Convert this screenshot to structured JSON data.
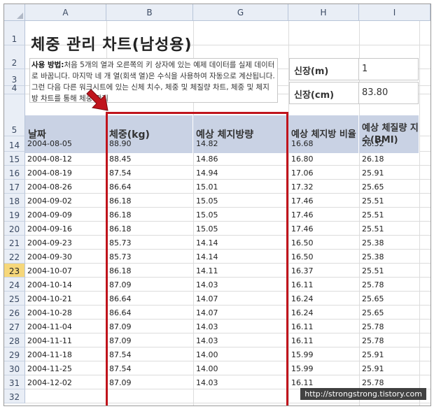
{
  "columns": [
    "A",
    "B",
    "G",
    "H",
    "I"
  ],
  "rows": [
    "1",
    "2",
    "3",
    "4",
    "5",
    "14",
    "15",
    "16",
    "17",
    "18",
    "19",
    "20",
    "21",
    "22",
    "23",
    "24",
    "25",
    "26",
    "27",
    "28",
    "29",
    "30",
    "31",
    "32"
  ],
  "selected_row": "23",
  "title": "체중 관리 차트(남성용)",
  "description": {
    "bold": "사용 방법:",
    "text": "처음 5개의 열과 오른쪽의 키 상자에 있는 예제 데이터를 실제 데이터로 바꿉니다. 마지막 네 개 열(회색 열)은 수식을 사용하여 자동으로 계산됩니다. 그런 다음 다른 워크시트에 있는 신체 치수, 체중 및 체질량 차트, 체중 및 체지방 차트를 통해 체중 관리"
  },
  "height_m_label": "신장(m)",
  "height_m_value": "1",
  "height_cm_label": "신장(cm)",
  "height_cm_value": "83.80",
  "headers": {
    "date": "날짜",
    "weight": "체중(kg)",
    "fat_amount": "예상 체지방량",
    "fat_ratio": "예상 체지방 비율",
    "bmi": "예상 체질량 지수(BMI)"
  },
  "table": [
    [
      "2004-08-05",
      "88.90",
      "14.82",
      "16.68",
      "26.32"
    ],
    [
      "2004-08-12",
      "88.45",
      "14.86",
      "16.80",
      "26.18"
    ],
    [
      "2004-08-19",
      "87.54",
      "14.94",
      "17.06",
      "25.91"
    ],
    [
      "2004-08-26",
      "86.64",
      "15.01",
      "17.32",
      "25.65"
    ],
    [
      "2004-09-02",
      "86.18",
      "15.05",
      "17.46",
      "25.51"
    ],
    [
      "2004-09-09",
      "86.18",
      "15.05",
      "17.46",
      "25.51"
    ],
    [
      "2004-09-16",
      "86.18",
      "15.05",
      "17.46",
      "25.51"
    ],
    [
      "2004-09-23",
      "85.73",
      "14.14",
      "16.50",
      "25.38"
    ],
    [
      "2004-09-30",
      "85.73",
      "14.14",
      "16.50",
      "25.38"
    ],
    [
      "2004-10-07",
      "86.18",
      "14.11",
      "16.37",
      "25.51"
    ],
    [
      "2004-10-14",
      "87.09",
      "14.03",
      "16.11",
      "25.78"
    ],
    [
      "2004-10-21",
      "86.64",
      "14.07",
      "16.24",
      "25.65"
    ],
    [
      "2004-10-28",
      "86.64",
      "14.07",
      "16.24",
      "25.65"
    ],
    [
      "2004-11-04",
      "87.09",
      "14.03",
      "16.11",
      "25.78"
    ],
    [
      "2004-11-11",
      "87.09",
      "14.03",
      "16.11",
      "25.78"
    ],
    [
      "2004-11-18",
      "87.54",
      "14.00",
      "15.99",
      "25.91"
    ],
    [
      "2004-11-25",
      "87.54",
      "14.00",
      "15.99",
      "25.91"
    ],
    [
      "2004-12-02",
      "87.09",
      "14.03",
      "16.11",
      "25.78"
    ]
  ],
  "watermark": "http://strongstrong.tistory.com",
  "colors": {
    "header_fill": "#c9d2e4",
    "highlight": "#c0141c",
    "selected_row": "#f6d77a"
  }
}
